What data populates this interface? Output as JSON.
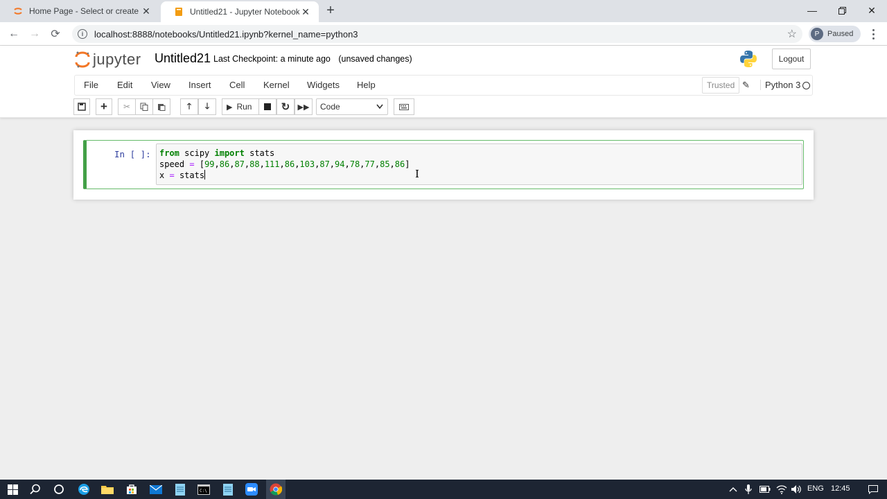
{
  "browser": {
    "tabs": [
      {
        "title": "Home Page - Select or create a n",
        "active": false
      },
      {
        "title": "Untitled21 - Jupyter Notebook",
        "active": true
      }
    ],
    "url": "localhost:8888/notebooks/Untitled21.ipynb?kernel_name=python3",
    "profile_initial": "P",
    "profile_status": "Paused"
  },
  "jupyter": {
    "logo_text": "jupyter",
    "notebook_name": "Untitled21",
    "checkpoint_label": "Last Checkpoint:",
    "checkpoint_time": "a minute ago",
    "unsaved": "(unsaved changes)",
    "logout_label": "Logout",
    "menu": [
      "File",
      "Edit",
      "View",
      "Insert",
      "Cell",
      "Kernel",
      "Widgets",
      "Help"
    ],
    "trusted_label": "Trusted",
    "kernel_name": "Python 3",
    "run_label": "Run",
    "cell_type": "Code"
  },
  "cell": {
    "prompt": "In [ ]:",
    "code_lines": [
      "from scipy import stats",
      "speed = [99,86,87,88,111,86,103,87,94,78,77,85,86]",
      "x = stats"
    ]
  },
  "taskbar": {
    "language": "ENG",
    "time": "12:45"
  },
  "colors": {
    "cell_border": "#43a047",
    "keyword": "#008000",
    "operator": "#aa22ff",
    "prompt": "#303f9f",
    "taskbar": "#1d2533"
  }
}
